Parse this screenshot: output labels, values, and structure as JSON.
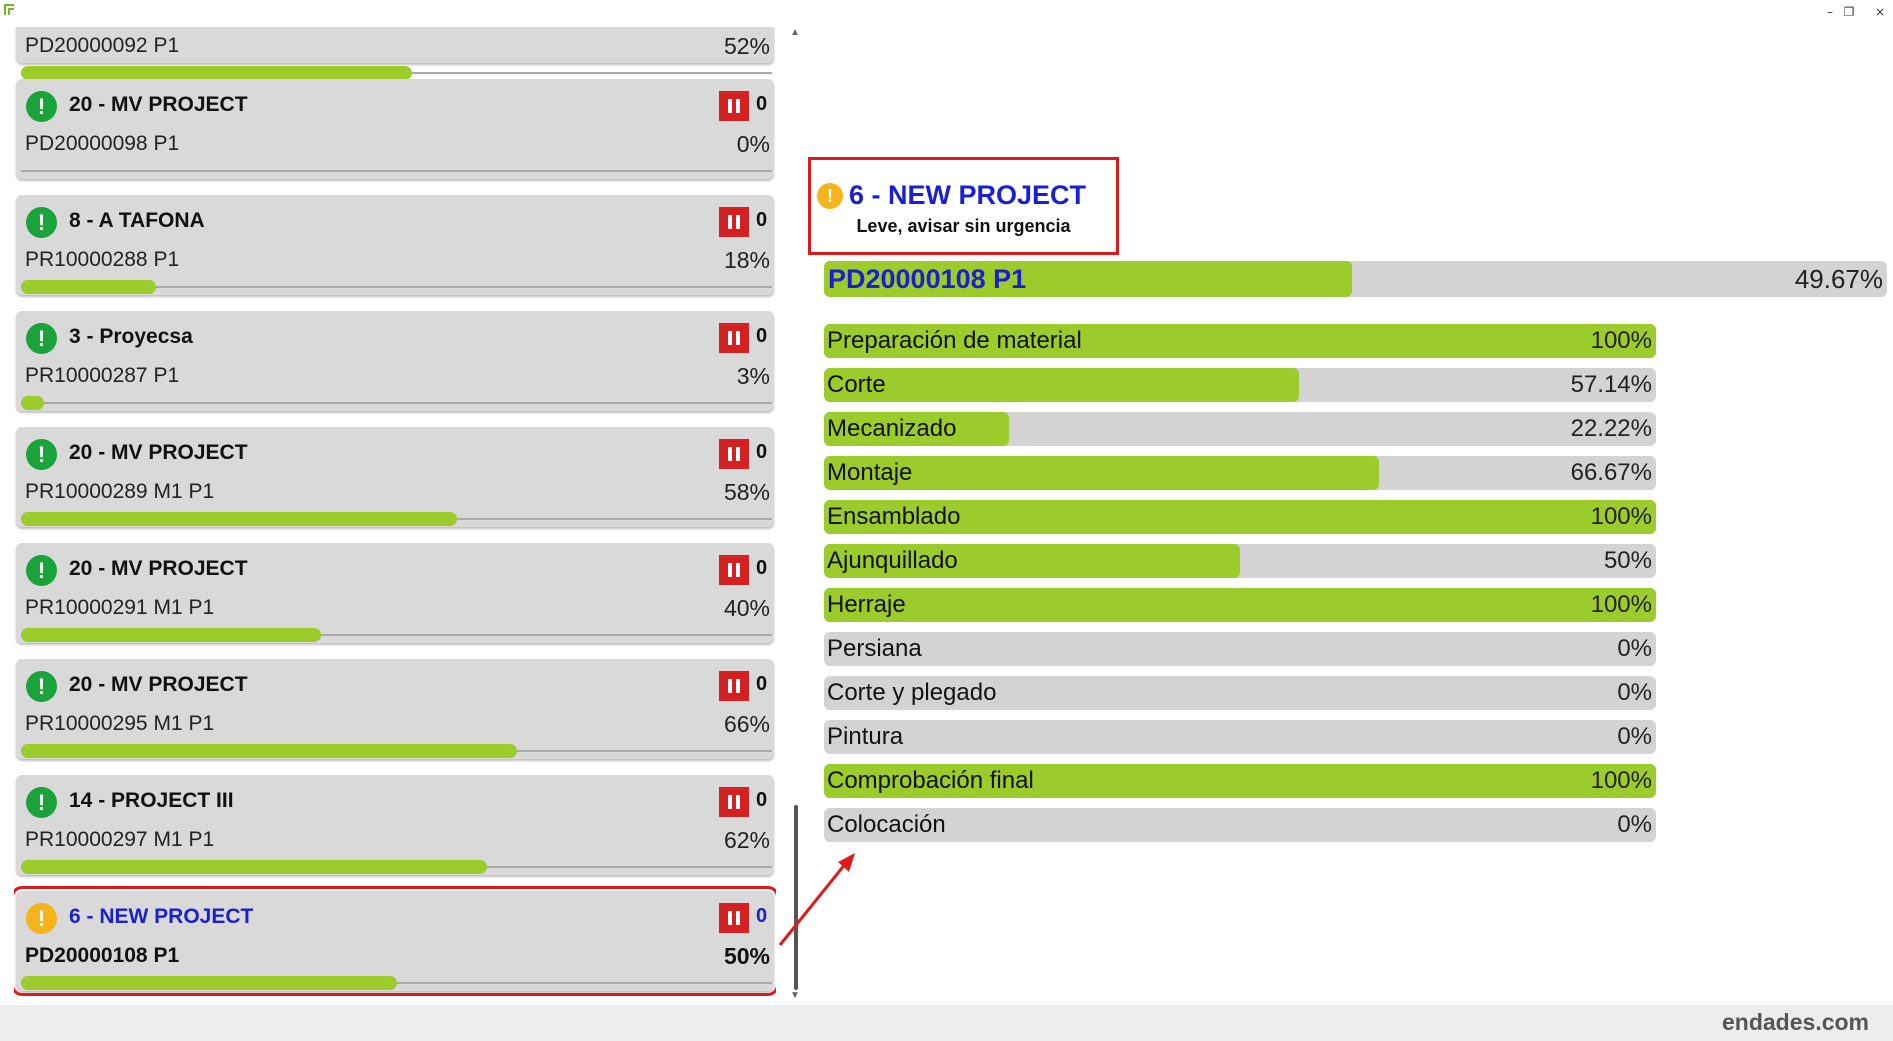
{
  "window": {
    "minimize_glyph": "–",
    "restore_glyph": "❐",
    "close_glyph": "×"
  },
  "list": {
    "partial_top": {
      "code": "PD20000092 P1",
      "percent": "52%",
      "progress": 0.52
    },
    "cards": [
      {
        "title": "20 - MV PROJECT",
        "count": "0",
        "code": "PD20000098 P1",
        "percent": "0%",
        "progress": 0,
        "status": "ok"
      },
      {
        "title": "8 - A TAFONA",
        "count": "0",
        "code": "PR10000288 P1",
        "percent": "18%",
        "progress": 0.18,
        "status": "ok"
      },
      {
        "title": "3 - Proyecsa",
        "count": "0",
        "code": "PR10000287 P1",
        "percent": "3%",
        "progress": 0.03,
        "status": "ok"
      },
      {
        "title": "20 - MV PROJECT",
        "count": "0",
        "code": "PR10000289 M1 P1",
        "percent": "58%",
        "progress": 0.58,
        "status": "ok"
      },
      {
        "title": "20 - MV PROJECT",
        "count": "0",
        "code": "PR10000291 M1 P1",
        "percent": "40%",
        "progress": 0.4,
        "status": "ok"
      },
      {
        "title": "20 - MV PROJECT",
        "count": "0",
        "code": "PR10000295 M1 P1",
        "percent": "66%",
        "progress": 0.66,
        "status": "ok"
      },
      {
        "title": "14 - PROJECT III",
        "count": "0",
        "code": "PR10000297 M1 P1",
        "percent": "62%",
        "progress": 0.62,
        "status": "ok"
      },
      {
        "title": "6 - NEW PROJECT",
        "count": "0",
        "code": "PD20000108 P1",
        "percent": "50%",
        "progress": 0.5,
        "status": "warn",
        "selected": true
      }
    ]
  },
  "detail": {
    "title": "6 - NEW PROJECT",
    "subtitle": "Leve, avisar sin urgencia",
    "order_code": "PD20000108 P1",
    "order_percent": "49.67%",
    "order_progress": 0.4967,
    "steps": [
      {
        "label": "Preparación de material",
        "value": "100%",
        "progress": 1.0
      },
      {
        "label": "Corte",
        "value": "57.14%",
        "progress": 0.5714
      },
      {
        "label": "Mecanizado",
        "value": "22.22%",
        "progress": 0.2222
      },
      {
        "label": "Montaje",
        "value": "66.67%",
        "progress": 0.6667
      },
      {
        "label": "Ensamblado",
        "value": "100%",
        "progress": 1.0
      },
      {
        "label": "Ajunquillado",
        "value": "50%",
        "progress": 0.5
      },
      {
        "label": "Herraje",
        "value": "100%",
        "progress": 1.0
      },
      {
        "label": "Persiana",
        "value": "0%",
        "progress": 0
      },
      {
        "label": "Corte y plegado",
        "value": "0%",
        "progress": 0
      },
      {
        "label": "Pintura",
        "value": "0%",
        "progress": 0
      },
      {
        "label": "Comprobación final",
        "value": "100%",
        "progress": 1.0
      },
      {
        "label": "Colocación",
        "value": "0%",
        "progress": 0
      }
    ]
  },
  "footer": {
    "brand": "endades.com"
  },
  "colors": {
    "progress_fill": "#9ccb2c",
    "highlight": "#e01a1a",
    "link_blue": "#1a1fd0",
    "ok": "#1aa33a",
    "warn": "#f5b41c",
    "pause": "#d42020"
  }
}
